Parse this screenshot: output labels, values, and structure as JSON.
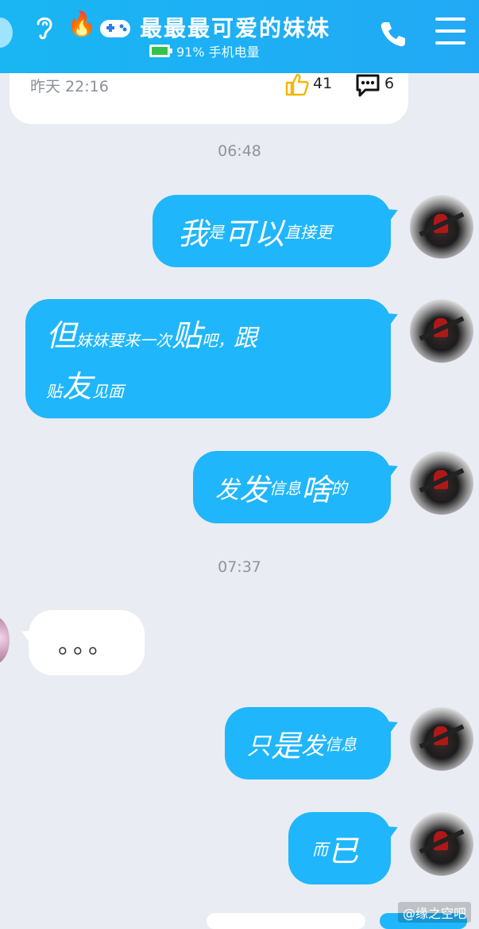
{
  "header": {
    "title": "最最最可爱的妹妹",
    "battery_text": "91% 手机电量",
    "battery_level": 0.91,
    "icons": [
      "ear-icon",
      "fire-icon",
      "gamepad-icon",
      "phone-icon",
      "menu-icon"
    ],
    "accent": "#1fb3f5"
  },
  "post": {
    "time": "昨天 22:16",
    "likes": "41",
    "comments": "6"
  },
  "timestamps": [
    "06:48",
    "07:37"
  ],
  "messages": [
    {
      "side": "right",
      "parts": [
        "我",
        "是",
        "可",
        "以",
        "直接",
        "更"
      ]
    },
    {
      "side": "right",
      "parts": [
        "但",
        "妹妹要来一次",
        "贴",
        "吧，",
        "跟",
        "贴",
        "友",
        "见面"
      ]
    },
    {
      "side": "right",
      "parts": [
        "发",
        "发",
        "信息",
        "啥",
        "的"
      ]
    },
    {
      "side": "left",
      "parts": [
        "。。。"
      ]
    },
    {
      "side": "right",
      "parts": [
        "只",
        "是",
        "发",
        "信息"
      ]
    },
    {
      "side": "right",
      "parts": [
        "而",
        "已"
      ]
    }
  ],
  "watermark": "@缘之空吧",
  "colors": {
    "bubble_blue": "#20b6fb",
    "background": "#e9ecf2"
  }
}
